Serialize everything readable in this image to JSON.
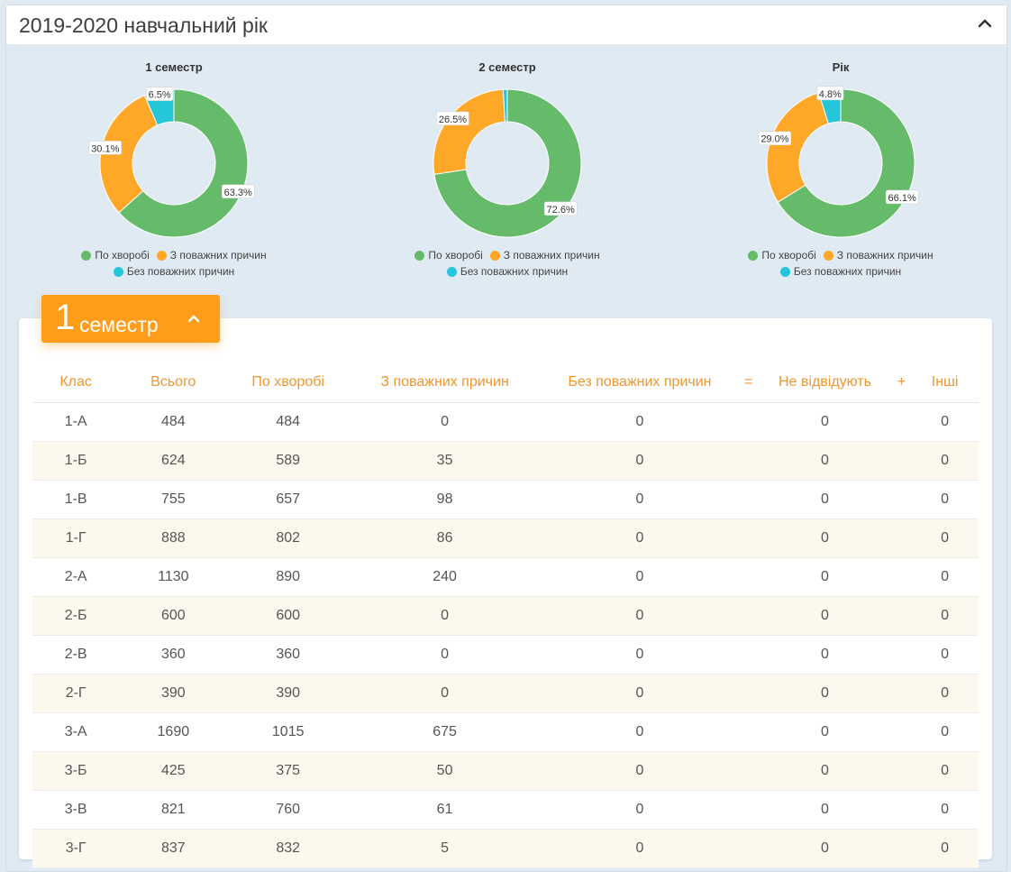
{
  "panel": {
    "title": "2019-2020 навчальний рік"
  },
  "chart_data": [
    {
      "type": "pie",
      "title": "1 семестр",
      "categories": [
        "По хворобі",
        "З поважних причин",
        "Без поважних причин"
      ],
      "values": [
        63.3,
        30.1,
        6.5
      ],
      "labels": [
        "63.3%",
        "30.1%",
        "6.5%"
      ],
      "colors": [
        "#66bb6a",
        "#ffa726",
        "#26c6da"
      ],
      "legend": "bottom"
    },
    {
      "type": "pie",
      "title": "2 семестр",
      "categories": [
        "По хворобі",
        "З поважних причин",
        "Без поважних причин"
      ],
      "values": [
        72.6,
        26.5,
        0.9
      ],
      "labels": [
        "72.6%",
        "26.5%",
        ""
      ],
      "colors": [
        "#66bb6a",
        "#ffa726",
        "#26c6da"
      ],
      "legend": "bottom"
    },
    {
      "type": "pie",
      "title": "Рік",
      "categories": [
        "По хворобі",
        "З поважних причин",
        "Без поважних причин"
      ],
      "values": [
        66.1,
        29.0,
        4.8
      ],
      "labels": [
        "66.1%",
        "29.0%",
        "4.8%"
      ],
      "colors": [
        "#66bb6a",
        "#ffa726",
        "#26c6da"
      ],
      "legend": "bottom"
    }
  ],
  "semester_card": {
    "number": "1",
    "label": "семестр"
  },
  "table": {
    "columns": [
      "Клас",
      "Всього",
      "По хворобі",
      "З поважних причин",
      "Без поважних причин",
      "=",
      "Не відвідують",
      "+",
      "Інші"
    ],
    "rows": [
      [
        "1-А",
        "484",
        "484",
        "0",
        "0",
        "",
        "0",
        "",
        "0"
      ],
      [
        "1-Б",
        "624",
        "589",
        "35",
        "0",
        "",
        "0",
        "",
        "0"
      ],
      [
        "1-В",
        "755",
        "657",
        "98",
        "0",
        "",
        "0",
        "",
        "0"
      ],
      [
        "1-Г",
        "888",
        "802",
        "86",
        "0",
        "",
        "0",
        "",
        "0"
      ],
      [
        "2-А",
        "1130",
        "890",
        "240",
        "0",
        "",
        "0",
        "",
        "0"
      ],
      [
        "2-Б",
        "600",
        "600",
        "0",
        "0",
        "",
        "0",
        "",
        "0"
      ],
      [
        "2-В",
        "360",
        "360",
        "0",
        "0",
        "",
        "0",
        "",
        "0"
      ],
      [
        "2-Г",
        "390",
        "390",
        "0",
        "0",
        "",
        "0",
        "",
        "0"
      ],
      [
        "3-А",
        "1690",
        "1015",
        "675",
        "0",
        "",
        "0",
        "",
        "0"
      ],
      [
        "3-Б",
        "425",
        "375",
        "50",
        "0",
        "",
        "0",
        "",
        "0"
      ],
      [
        "3-В",
        "821",
        "760",
        "61",
        "0",
        "",
        "0",
        "",
        "0"
      ],
      [
        "3-Г",
        "837",
        "832",
        "5",
        "0",
        "",
        "0",
        "",
        "0"
      ]
    ]
  }
}
